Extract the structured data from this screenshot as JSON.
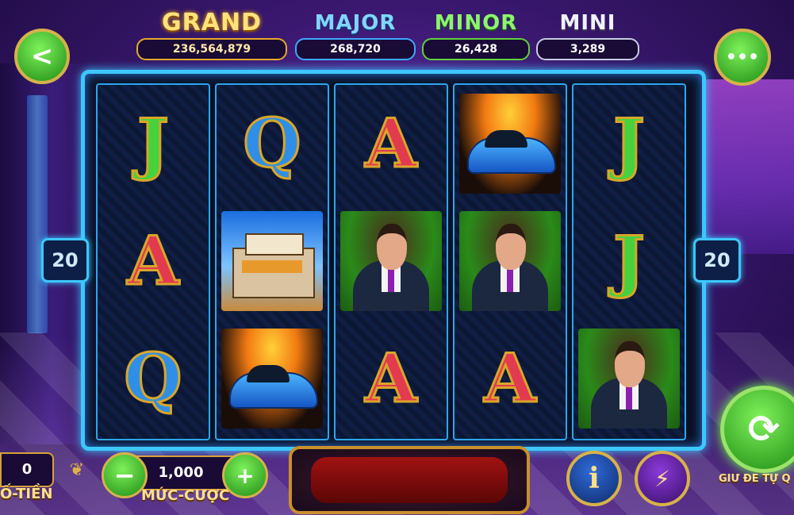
{
  "jackpots": {
    "grand": {
      "label": "GRAND",
      "amount": "236,564,879"
    },
    "major": {
      "label": "MAJOR",
      "amount": "268,720"
    },
    "minor": {
      "label": "MINOR",
      "amount": "26,428"
    },
    "mini": {
      "label": "MINI",
      "amount": "3,289"
    }
  },
  "nav": {
    "back_icon": "<",
    "menu_icon": "•••"
  },
  "reels": [
    [
      "J",
      "A",
      "Q"
    ],
    [
      "Q",
      "house",
      "car"
    ],
    [
      "A",
      "man",
      "A"
    ],
    [
      "car",
      "man",
      "A"
    ],
    [
      "J",
      "J",
      "man"
    ]
  ],
  "paylines": {
    "left": "20",
    "right": "20"
  },
  "controls": {
    "balance_value": "0",
    "balance_label": "Ố-TIỀN",
    "bet_value": "1,000",
    "bet_label": "MỨC-CƯỢC",
    "minus_icon": "−",
    "plus_icon": "+",
    "info_icon": "i",
    "turbo_icon": "⚡",
    "spin_icon": "⟳",
    "spin_label": "GIỮ ĐỂ TỰ Q"
  }
}
